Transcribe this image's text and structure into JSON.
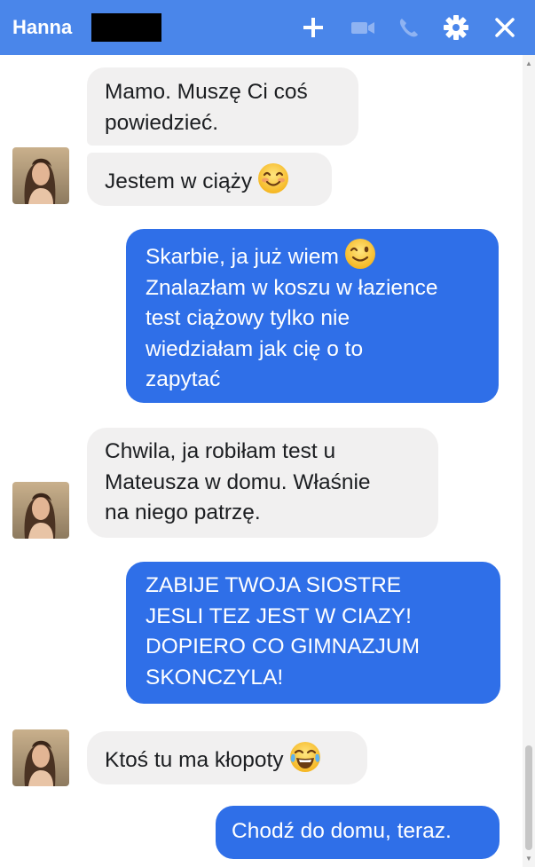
{
  "header": {
    "contact_name": "Hanna",
    "icons": [
      "plus-icon",
      "video-camera-icon",
      "phone-icon",
      "gear-icon",
      "close-icon"
    ],
    "accent_color": "#4a86ea"
  },
  "messages": [
    {
      "side": "incoming",
      "lines": [
        "Mamo. Muszę Ci coś",
        "powiedzieć."
      ],
      "emoji": null
    },
    {
      "side": "incoming",
      "lines": [
        "Jestem w ciąży"
      ],
      "emoji": "smiling-face-emoji"
    },
    {
      "side": "outgoing",
      "lines": [
        "Skarbie, ja już wiem",
        "Znalazłam w koszu w łazience",
        "test ciążowy tylko nie",
        "wiedziałam jak cię o to",
        "zapytać"
      ],
      "emoji": "winking-face-emoji"
    },
    {
      "side": "incoming",
      "lines": [
        "Chwila, ja robiłam test u",
        "Mateusza w domu. Właśnie",
        "na niego patrzę."
      ],
      "emoji": null
    },
    {
      "side": "outgoing",
      "lines": [
        "ZABIJE TWOJA SIOSTRE",
        "JESLI TEZ JEST W CIAZY!",
        "DOPIERO CO GIMNAZJUM",
        "SKONCZYLA!"
      ],
      "emoji": null
    },
    {
      "side": "incoming",
      "lines": [
        "Ktoś tu ma kłopoty"
      ],
      "emoji": "tears-of-joy-emoji"
    },
    {
      "side": "outgoing",
      "lines": [
        "Chodź do domu, teraz."
      ],
      "emoji": null
    }
  ],
  "colors": {
    "incoming_bubble": "#f1f0f0",
    "outgoing_bubble": "#2f6fe8"
  }
}
